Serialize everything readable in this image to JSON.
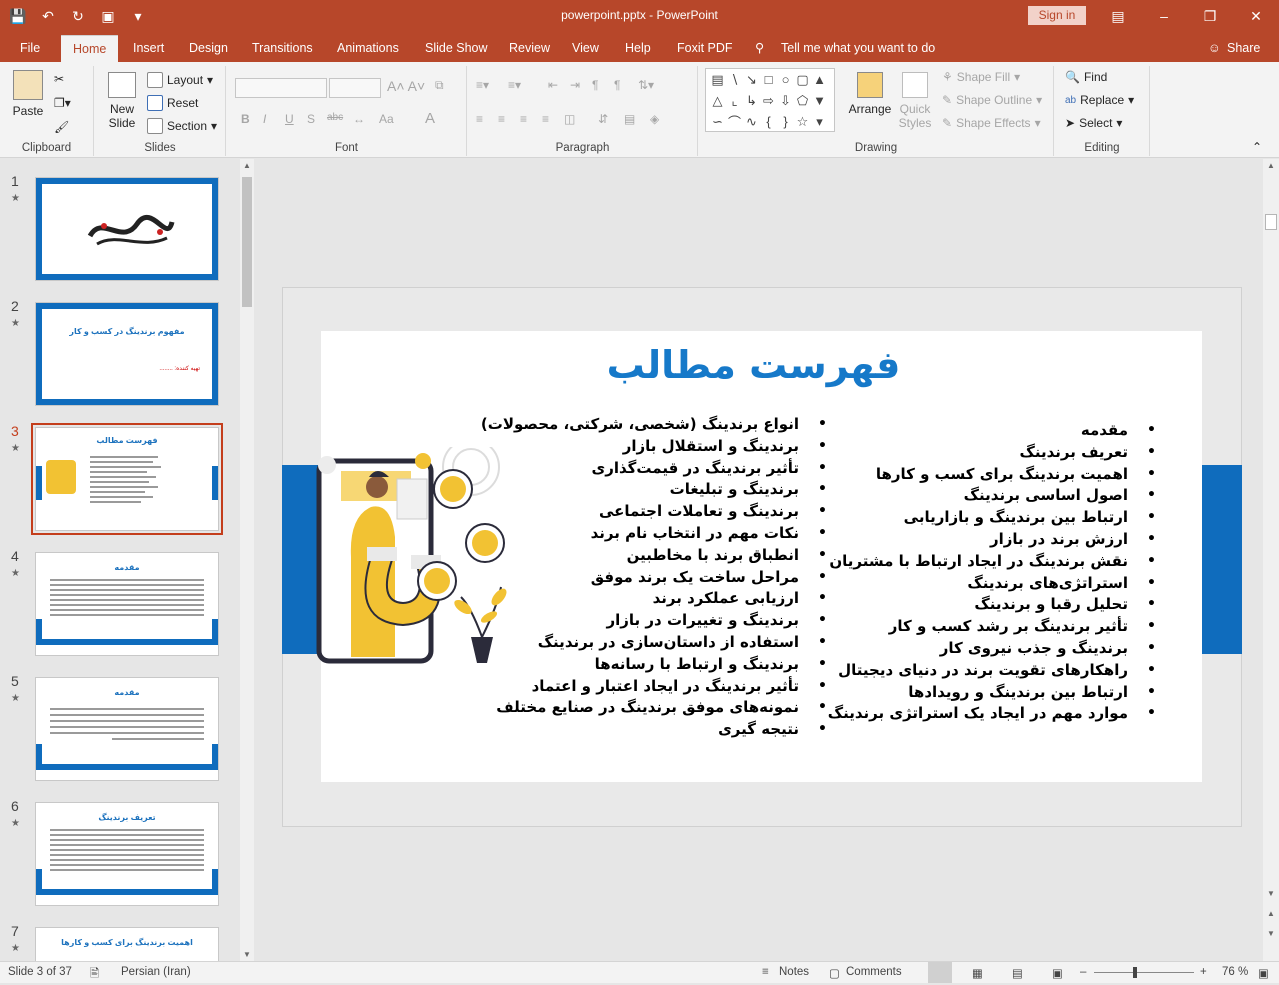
{
  "app": {
    "doc_title": "powerpoint.pptx  -  PowerPoint",
    "signin_label": "Sign in"
  },
  "tabs": [
    "File",
    "Home",
    "Insert",
    "Design",
    "Transitions",
    "Animations",
    "Slide Show",
    "Review",
    "View",
    "Help",
    "Foxit PDF"
  ],
  "tell_me": "Tell me what you want to do",
  "share_label": "Share",
  "ribbon": {
    "clipboard": {
      "paste": "Paste",
      "label": "Clipboard"
    },
    "slides": {
      "new_slide_1": "New",
      "new_slide_2": "Slide",
      "layout": "Layout",
      "reset": "Reset",
      "section": "Section",
      "label": "Slides"
    },
    "font": {
      "label": "Font",
      "bold": "B",
      "italic": "I",
      "underline": "U",
      "strike": "S",
      "abc": "abc",
      "aa": "Aa",
      "font_color": "A"
    },
    "paragraph": {
      "label": "Paragraph"
    },
    "drawing": {
      "arrange": "Arrange",
      "quick_1": "Quick",
      "quick_2": "Styles",
      "shape_fill": "Shape Fill",
      "shape_outline": "Shape Outline",
      "shape_effects": "Shape Effects",
      "label": "Drawing"
    },
    "editing": {
      "find": "Find",
      "replace": "Replace",
      "select": "Select",
      "label": "Editing"
    }
  },
  "thumbnails": [
    {
      "num": "1",
      "title": ""
    },
    {
      "num": "2",
      "title": "مفهوم برندینگ در کسب و کار",
      "sub": "تهیه کننده: ........"
    },
    {
      "num": "3",
      "title": "فهرست مطالب"
    },
    {
      "num": "4",
      "title": "مقدمه"
    },
    {
      "num": "5",
      "title": "مقدمه"
    },
    {
      "num": "6",
      "title": "تعریف برندینگ"
    },
    {
      "num": "7",
      "title": "اهمیت برندینگ برای کسب و کارها"
    }
  ],
  "slide": {
    "title": "فهرست مطالب",
    "right_column": [
      "مقدمه",
      "تعریف برندینگ",
      "اهمیت برندینگ برای کسب و کارها",
      "اصول اساسی برندینگ",
      "ارتباط بین برندینگ و بازاریابی",
      "ارزش برند در بازار",
      "نقش برندینگ در ایجاد ارتباط با مشتریان",
      "استراتژی‌های برندینگ",
      "تحلیل رقبا و برندینگ",
      "تأثیر برندینگ بر رشد کسب و کار",
      "برندینگ و جذب نیروی کار",
      "راهکارهای تقویت برند در دنیای دیجیتال",
      "ارتباط بین برندینگ و رویدادها",
      "موارد مهم در ایجاد یک استراتژی برندینگ"
    ],
    "left_column": [
      "انواع برندینگ (شخصی، شرکتی، محصولات)",
      "برندینگ و استقلال بازار",
      "تأثیر برندینگ در قیمت‌گذاری",
      "برندینگ و تبلیغات",
      "برندینگ و تعاملات اجتماعی",
      "نکات مهم در انتخاب نام برند",
      "انطباق برند با مخاطبین",
      "مراحل ساخت یک برند موفق",
      "ارزیابی عملکرد برند",
      "برندینگ و تغییرات در بازار",
      "استفاده از داستان‌سازی در برندینگ",
      "برندینگ و ارتباط با رسانه‌ها",
      "تأثیر برندینگ در ایجاد اعتبار و اعتماد",
      "نمونه‌های موفق برندینگ در صنایع مختلف",
      "نتیجه گیری"
    ]
  },
  "status": {
    "slide_info": "Slide 3 of 37",
    "language": "Persian (Iran)",
    "notes": "Notes",
    "comments": "Comments",
    "zoom": "76 %"
  },
  "colors": {
    "accent": "#b7472a",
    "slide_blue": "#0f6cbd",
    "title_blue": "#1679c9"
  }
}
